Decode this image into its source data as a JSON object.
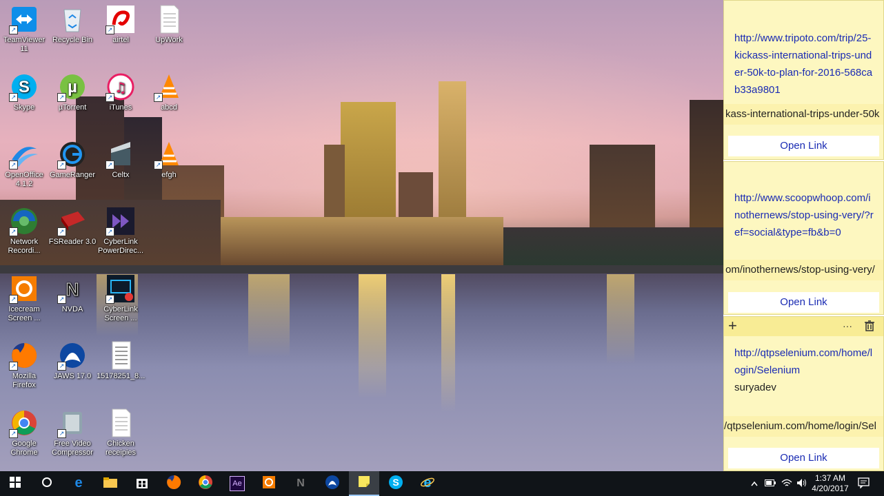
{
  "desktop_icons": [
    {
      "label": "TeamViewer 11",
      "icon": "teamviewer-icon"
    },
    {
      "label": "Recycle Bin",
      "icon": "recycle-bin-icon"
    },
    {
      "label": "airtel",
      "icon": "airtel-icon"
    },
    {
      "label": "UpWork",
      "icon": "document-icon"
    },
    {
      "label": "Skype",
      "icon": "skype-icon"
    },
    {
      "label": "µTorrent",
      "icon": "utorrent-icon"
    },
    {
      "label": "iTunes",
      "icon": "itunes-icon"
    },
    {
      "label": "abcd",
      "icon": "vlc-icon"
    },
    {
      "label": "OpenOffice 4.1.2",
      "icon": "openoffice-icon"
    },
    {
      "label": "GameRanger",
      "icon": "gameranger-icon"
    },
    {
      "label": "Celtx",
      "icon": "celtx-icon"
    },
    {
      "label": "efgh",
      "icon": "vlc-icon"
    },
    {
      "label": "Network Recordi...",
      "icon": "network-recorder-icon"
    },
    {
      "label": "FSReader 3.0",
      "icon": "fsreader-icon"
    },
    {
      "label": "CyberLink PowerDirec...",
      "icon": "powerdirector-icon"
    },
    {
      "label": "Icecream Screen ...",
      "icon": "icecream-icon"
    },
    {
      "label": "NVDA",
      "icon": "nvda-icon"
    },
    {
      "label": "CyberLink Screen ...",
      "icon": "cyberlink-screen-icon"
    },
    {
      "label": "Mozilla Firefox",
      "icon": "firefox-icon"
    },
    {
      "label": "JAWS 17.0",
      "icon": "jaws-icon"
    },
    {
      "label": "15178251_8...",
      "icon": "image-file-icon"
    },
    {
      "label": "Google Chrome",
      "icon": "chrome-icon"
    },
    {
      "label": "Free Video Compressor",
      "icon": "video-compressor-icon"
    },
    {
      "label": "Chicken receipies",
      "icon": "document-icon"
    }
  ],
  "sticky_notes": {
    "notes": [
      {
        "url": "http://www.tripoto.com/trip/25-kickass-international-trips-under-50k-to-plan-for-2016-568cab33a9801",
        "link_preview": "kass-international-trips-under-50k",
        "open_label": "Open Link"
      },
      {
        "url": "http://www.scoopwhoop.com/inothernews/stop-using-very/?ref=social&type=fb&b=0",
        "link_preview": "om/inothernews/stop-using-very/",
        "open_label": "Open Link"
      },
      {
        "url": "http://qtpselenium.com/home/login/Selenium",
        "extra": "suryadev",
        "link_preview": "/qtpselenium.com/home/login/Sel",
        "open_label": "Open Link"
      }
    ],
    "toolbar": {
      "add": "+",
      "more": "···",
      "delete_icon": "trash-icon"
    }
  },
  "taskbar": {
    "apps": [
      "start-icon",
      "cortana-icon",
      "edge-icon",
      "file-explorer-icon",
      "store-icon",
      "firefox-icon",
      "chrome-icon",
      "after-effects-icon",
      "icecream-icon",
      "nvda-icon",
      "jaws-icon",
      "sticky-notes-icon",
      "skype-icon",
      "ie-icon"
    ],
    "ae_label": "Ae",
    "time": "1:37 AM",
    "date": "4/20/2017"
  },
  "colors": {
    "taskbar": "#101418",
    "note_bg": "#fdf7c0",
    "link": "#1a2bb3"
  }
}
